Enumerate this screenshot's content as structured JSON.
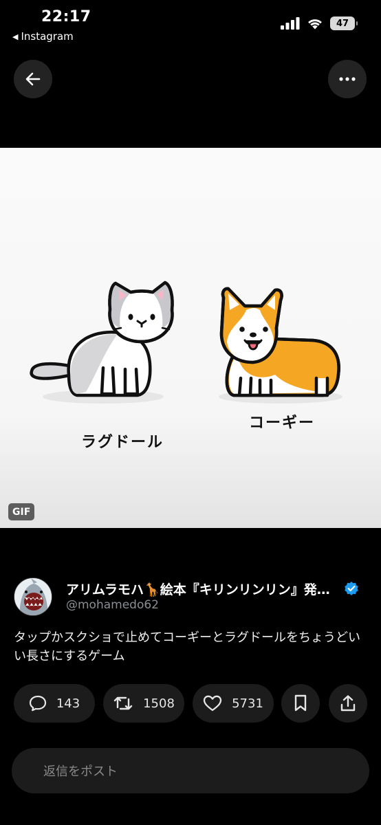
{
  "status_bar": {
    "time": "22:17",
    "back_app": "Instagram",
    "battery": "47"
  },
  "media": {
    "badge": "GIF",
    "cat_label": "ラグドール",
    "dog_label": "コーギー"
  },
  "post": {
    "author_name": "アリムラモハ🦒絵本『キリンリンリン』発売中",
    "author_handle": "@mohamedo62",
    "text": "タップかスクショで止めてコーギーとラグドールをちょうどいい長さにするゲーム"
  },
  "actions": {
    "replies": "143",
    "reposts": "1508",
    "likes": "5731"
  },
  "reply_input": {
    "placeholder": "返信をポスト"
  },
  "colors": {
    "accent_verified": "#1d9bf0",
    "corgi_orange": "#f5a623"
  }
}
